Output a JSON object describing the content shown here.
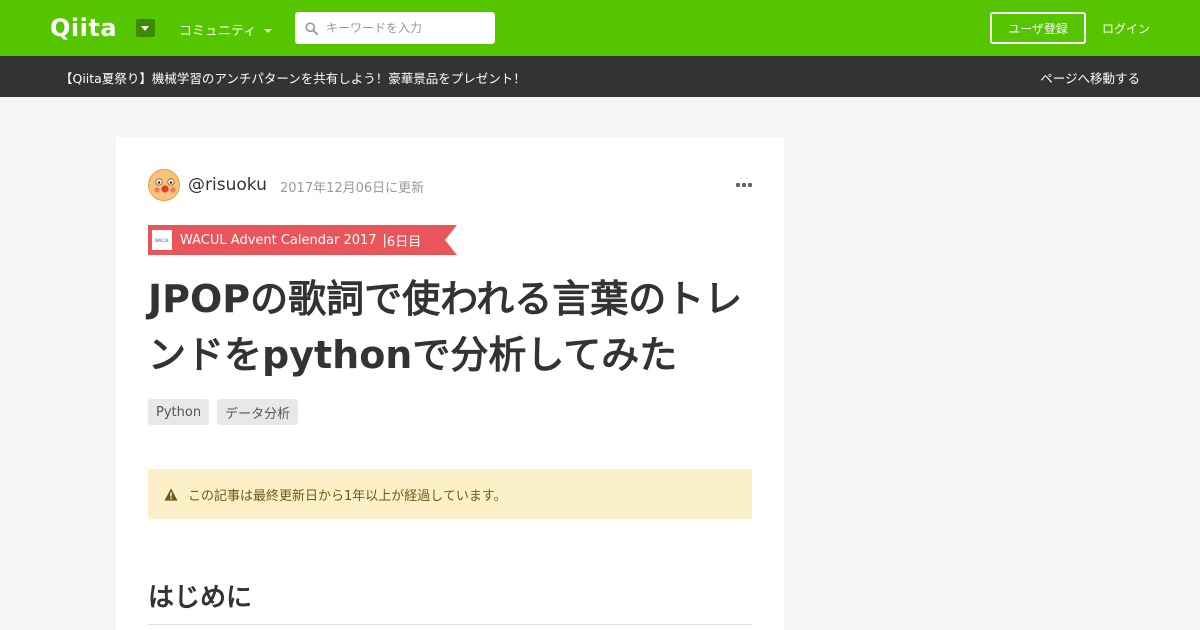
{
  "header": {
    "logo": "Qiita",
    "community_label": "コミュニティ",
    "search_placeholder": "キーワードを入力",
    "signup_label": "ユーザ登録",
    "login_label": "ログイン",
    "brand_color": "#55c500"
  },
  "banner": {
    "text": "【Qiita夏祭り】機械学習のアンチパターンを共有しよう！豪華景品をプレゼント！",
    "link": "ページへ移動する"
  },
  "article": {
    "author": "@risuoku",
    "updated": "2017年12月06日に更新",
    "advent": {
      "calendar": "WACUL Advent Calendar 2017",
      "separator": "|",
      "day": "6日目",
      "color": "#e8555a"
    },
    "title": "JPOPの歌詞で使われる言葉のトレンドをpythonで分析してみた",
    "tags": [
      "Python",
      "データ分析"
    ],
    "alert": "この記事は最終更新日から1年以上が経過しています。",
    "first_heading": "はじめに"
  }
}
